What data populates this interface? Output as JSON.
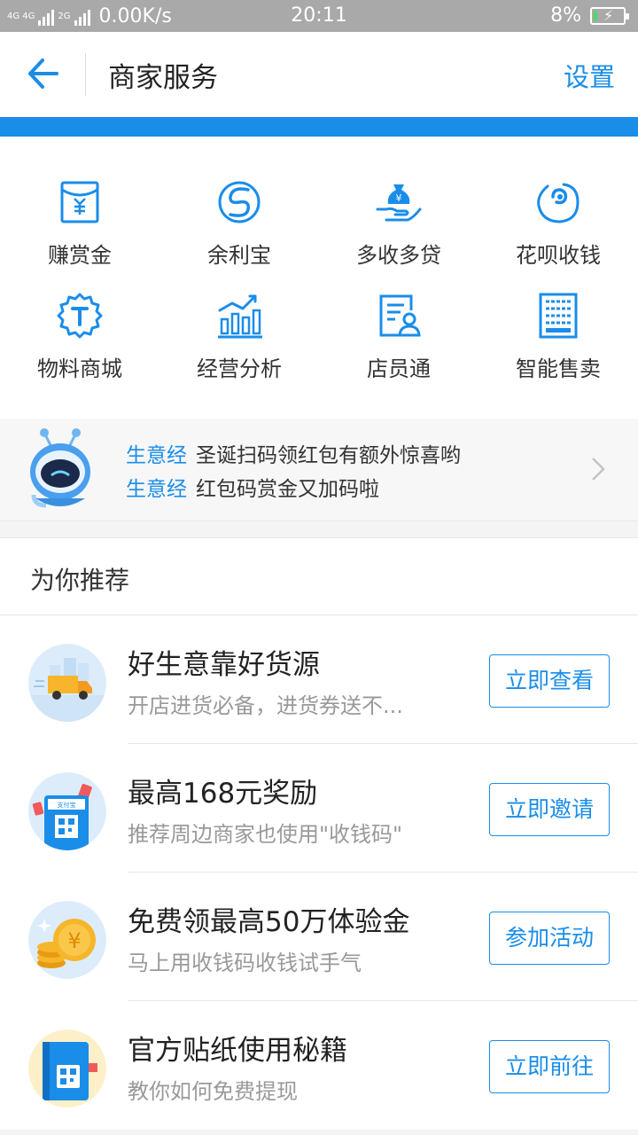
{
  "status": {
    "network": "4G 4G",
    "network2": "2G",
    "speed": "0.00K/s",
    "time": "20:11",
    "battery": "8%"
  },
  "nav": {
    "title": "商家服务",
    "settings": "设置"
  },
  "services": [
    {
      "label": "赚赏金",
      "icon": "reward-envelope-icon"
    },
    {
      "label": "余利宝",
      "icon": "yulibao-icon"
    },
    {
      "label": "多收多贷",
      "icon": "money-bag-hand-icon"
    },
    {
      "label": "花呗收钱",
      "icon": "huabei-icon"
    },
    {
      "label": "物料商城",
      "icon": "t-badge-icon"
    },
    {
      "label": "经营分析",
      "icon": "bar-chart-icon"
    },
    {
      "label": "店员通",
      "icon": "staff-document-icon"
    },
    {
      "label": "智能售卖",
      "icon": "vending-machine-icon"
    }
  ],
  "banner": {
    "lines": [
      {
        "tag": "生意经",
        "text": "圣诞扫码领红包有额外惊喜哟"
      },
      {
        "tag": "生意经",
        "text": "红包码赏金又加码啦"
      }
    ]
  },
  "recommend": {
    "heading": "为你推荐",
    "items": [
      {
        "title": "好生意靠好货源",
        "subtitle": "开店进货必备，进货券送不...",
        "button": "立即查看"
      },
      {
        "title": "最高168元奖励",
        "subtitle": "推荐周边商家也使用\"收钱码\"",
        "button": "立即邀请"
      },
      {
        "title": "免费领最高50万体验金",
        "subtitle": "马上用收钱码收钱试手气",
        "button": "参加活动"
      },
      {
        "title": "官方贴纸使用秘籍",
        "subtitle": "教你如何免费提现",
        "button": "立即前往"
      }
    ]
  },
  "colors": {
    "accent": "#1a8de9",
    "statusbar": "#a9a9a9"
  }
}
